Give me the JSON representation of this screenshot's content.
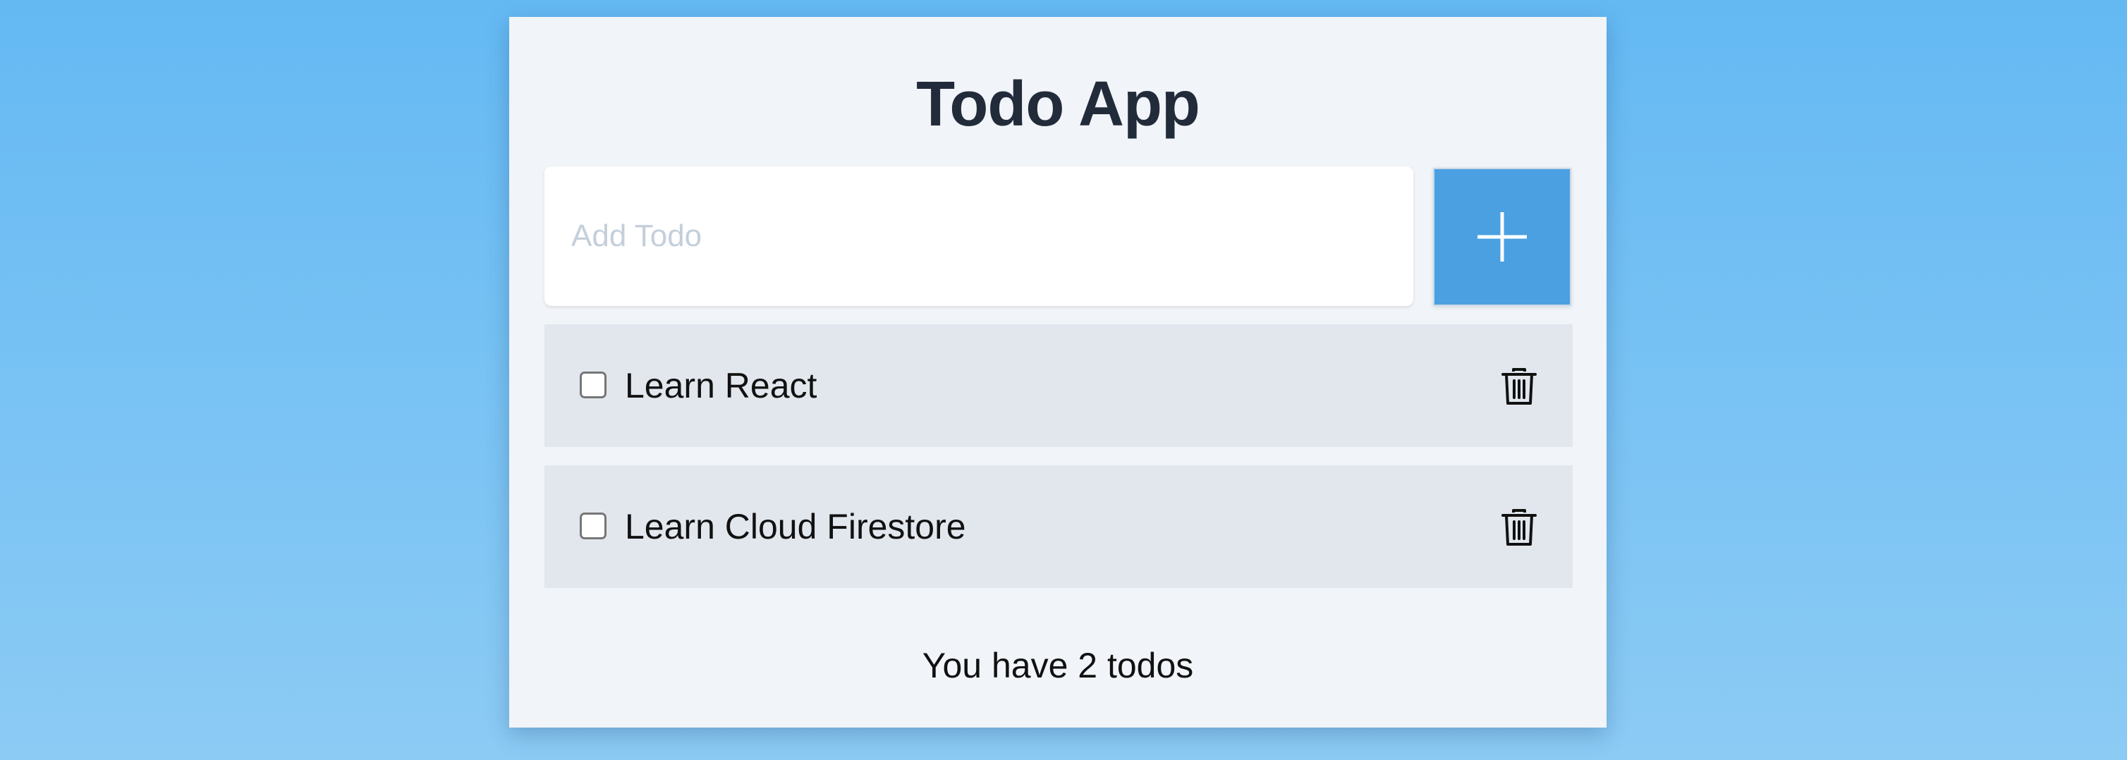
{
  "app": {
    "title": "Todo App"
  },
  "add_form": {
    "placeholder": "Add Todo",
    "value": "",
    "button_icon": "plus-icon"
  },
  "todos": [
    {
      "text": "Learn React",
      "completed": false,
      "delete_icon": "trash-icon"
    },
    {
      "text": "Learn Cloud Firestore",
      "completed": false,
      "delete_icon": "trash-icon"
    }
  ],
  "footer": {
    "count_text": "You have 2 todos"
  },
  "colors": {
    "background_top": "#64b9f3",
    "background_bottom": "#8ccbf4",
    "card": "#f1f4f8",
    "accent": "#4aa0e0",
    "item_background": "#e2e7ee",
    "title": "#222b3a"
  }
}
